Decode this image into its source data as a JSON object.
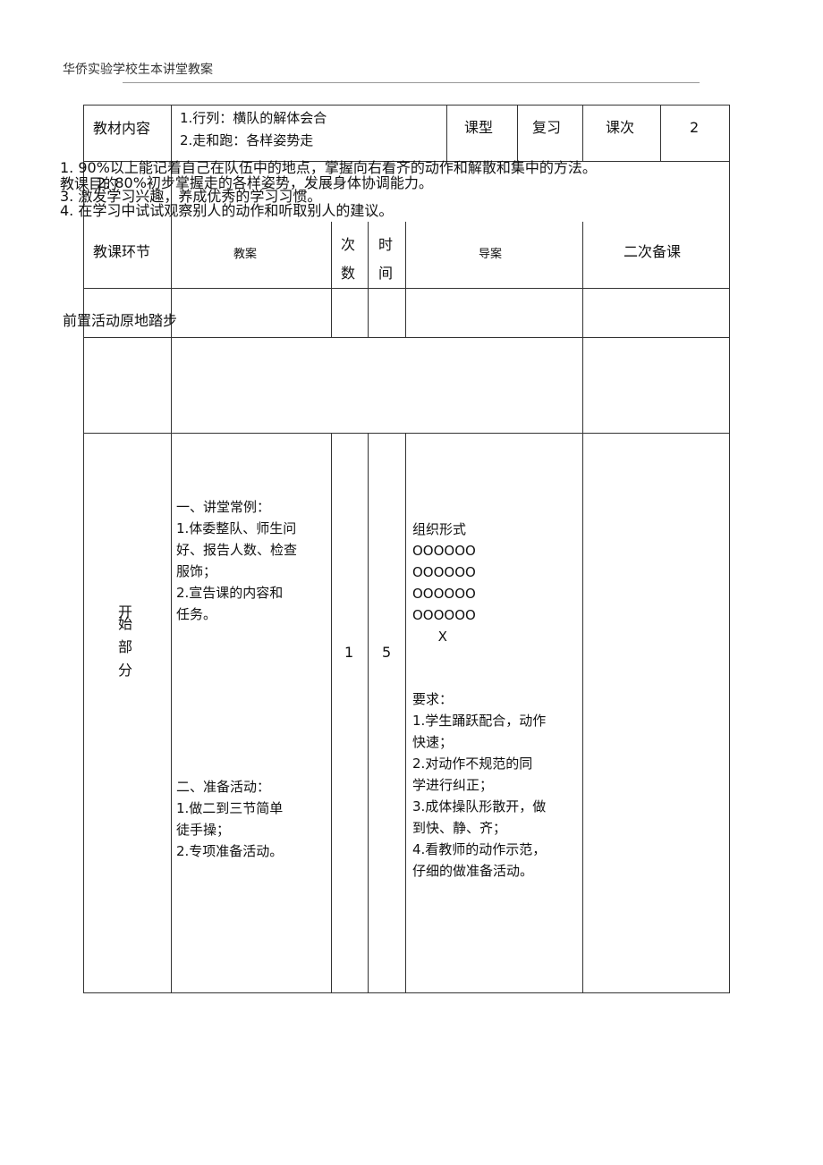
{
  "header": {
    "school_title": "华侨实验学校生本讲堂教案"
  },
  "info_row": {
    "material_label": "教材内容",
    "material_items": [
      "1.行列：横队的解体会合",
      "2.走和跑：各样姿势走"
    ],
    "type_label": "课型",
    "type_value": "复习",
    "lesson_no_label": "课次",
    "lesson_no_value": "2"
  },
  "objectives": {
    "label": "教课目的",
    "items": [
      "1.  90%以上能记着自己在队伍中的地点，掌握向右看齐的动作和解散和集中的方法。",
      "2.  80%初步掌握走的各样姿势，发展身体协调能力。",
      "3.  激发学习兴趣，养成优秀的学习习惯。",
      "4.  在学习中试试观察别人的动作和听取别人的建议。"
    ]
  },
  "columns": {
    "stage": "教课环节",
    "plan": "教案",
    "count": "次\n数",
    "time": "时\n间",
    "guide": "导案",
    "second_prep": "二次备课"
  },
  "pre_activity": {
    "label": "前置活动原地踏步"
  },
  "start_section": {
    "stage": "开\n始\n\n部\n\n分",
    "plan_part1": "一、讲堂常例：\n1.体委整队、师生问\n好、报告人数、检查\n服饰；\n2.宣告课的内容和\n任务。",
    "plan_part2": "二、准备活动：\n1.做二到三节简单\n徒手操；\n2.专项准备活动。",
    "count": "1",
    "time": "5",
    "guide_formation": "组织形式\nOOOOOO\nOOOOOO\nOOOOOO\nOOOOOO\n      X",
    "guide_requirements": "要求：\n1.学生踊跃配合，动作\n快速；\n2.对动作不规范的同\n学进行纠正；\n3.成体操队形散开，做\n到快、静、齐；\n4.看教师的动作示范，\n仔细的做准备活动。"
  }
}
